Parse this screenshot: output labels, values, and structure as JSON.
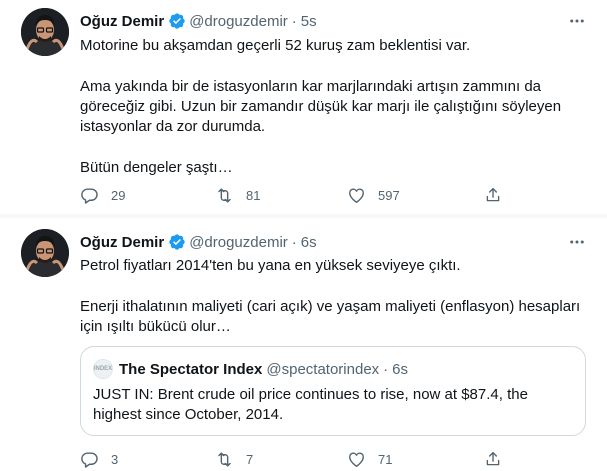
{
  "tweets": [
    {
      "author_name": "Oğuz Demir",
      "handle": "@droguzdemir",
      "dot": "·",
      "time": "5s",
      "paragraphs": [
        "Motorine bu akşamdan geçerli 52 kuruş zam beklentisi var.",
        "Ama yakında bir de istasyonların kar marjlarındaki artışın zammını da göreceğiz gibi. Uzun bir zamandır düşük kar marjı ile çalıştığını söyleyen istasyonlar da zor durumda.",
        "Bütün dengeler şaştı…"
      ],
      "reply_count": "29",
      "retweet_count": "81",
      "like_count": "597"
    },
    {
      "author_name": "Oğuz Demir",
      "handle": "@droguzdemir",
      "dot": "·",
      "time": "6s",
      "paragraphs": [
        "Petrol fiyatları 2014'ten bu yana en yüksek seviyeye çıktı.",
        "Enerji ithalatının maliyeti (cari açık) ve yaşam maliyeti (enflasyon) hesapları için ışıltı bükücü olur…"
      ],
      "quote": {
        "avatar_text": "INDEX",
        "author_name": "The Spectator Index",
        "handle": "@spectatorindex",
        "dot": "·",
        "time": "6s",
        "text": "JUST IN: Brent crude oil price continues to rise, now at $87.4, the highest since October, 2014."
      },
      "reply_count": "3",
      "retweet_count": "7",
      "like_count": "71"
    }
  ],
  "icons": {
    "verified": "verified-badge-icon",
    "more": "more-icon",
    "reply": "reply-icon",
    "retweet": "retweet-icon",
    "like": "heart-icon",
    "share": "share-icon"
  },
  "colors": {
    "verified_blue": "#1d9bf0",
    "secondary_text": "#536471",
    "primary_text": "#0f1419",
    "border": "#cfd9de"
  }
}
